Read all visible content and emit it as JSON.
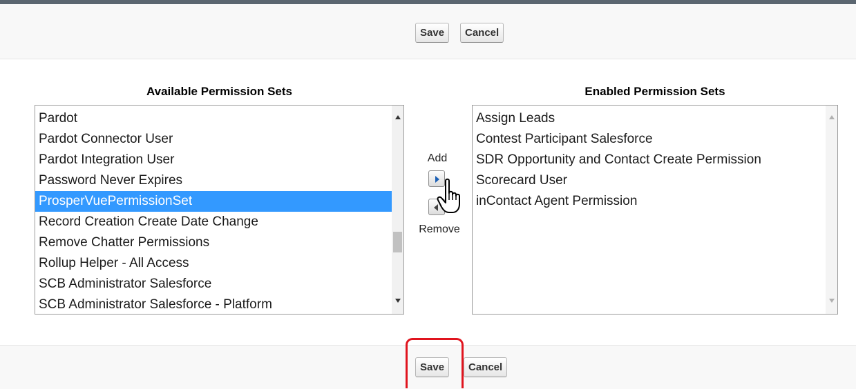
{
  "toolbar": {
    "save_label": "Save",
    "cancel_label": "Cancel"
  },
  "available": {
    "heading": "Available Permission Sets",
    "items": [
      "Pardot",
      "Pardot Connector User",
      "Pardot Integration User",
      "Password Never Expires",
      "ProsperVuePermissionSet",
      "Record Creation Create Date Change",
      "Remove Chatter Permissions",
      "Rollup Helper - All Access",
      "SCB Administrator Salesforce",
      "SCB Administrator Salesforce - Platform"
    ],
    "selected_item": "ProsperVuePermissionSet"
  },
  "move": {
    "add_label": "Add",
    "remove_label": "Remove"
  },
  "enabled": {
    "heading": "Enabled Permission Sets",
    "items": [
      "Assign Leads",
      "Contest Participant Salesforce",
      "SDR Opportunity and Contact Create Permission",
      "Scorecard User",
      "inContact Agent Permission"
    ]
  },
  "annotation": {
    "highlight_color": "#e0141e"
  },
  "colors": {
    "selection": "#3399ff",
    "add_arrow": "#1b5fb4"
  }
}
